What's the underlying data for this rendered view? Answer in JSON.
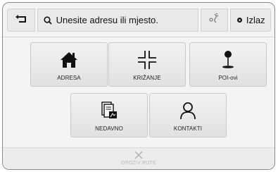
{
  "topbar": {
    "back_icon": "return-arrow-icon",
    "search_icon": "search-icon",
    "search_placeholder": "Unesite adresu ili mjesto.",
    "voice_icon": "voice-route-icon",
    "exit_icon": "exit-dot-icon",
    "exit_label": "Izlaz"
  },
  "tiles": {
    "adresa": {
      "label": "ADRESA",
      "icon": "house-icon"
    },
    "krizanje": {
      "label": "KRIŽANJE",
      "icon": "intersection-icon"
    },
    "poi": {
      "label": "POI-ovi",
      "icon": "poi-pin-icon"
    },
    "nedavno": {
      "label": "NEDAVNO",
      "icon": "recent-destinations-icon"
    },
    "kontakti": {
      "label": "KONTAKTI",
      "icon": "contact-person-icon"
    }
  },
  "bottom": {
    "cancel_icon": "close-icon",
    "cancel_label": "OPOZIV RUTE",
    "cancel_state": "disabled"
  }
}
